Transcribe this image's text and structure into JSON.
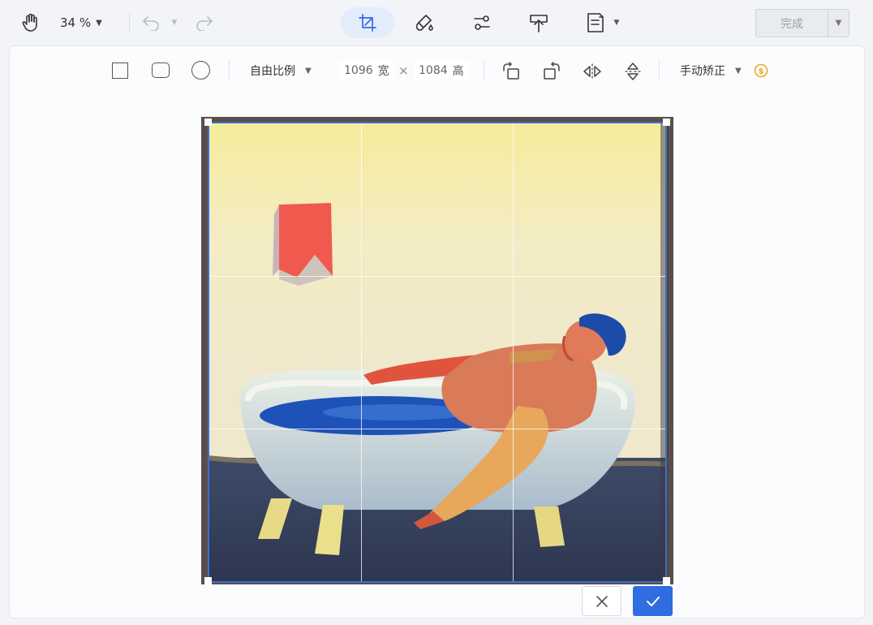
{
  "toolbar": {
    "zoom_value": "34 %",
    "done_label": "完成"
  },
  "crop_toolbar": {
    "ratio_label": "自由比例",
    "width_value": "1096",
    "width_unit": "宽",
    "times": "×",
    "height_value": "1084",
    "height_unit": "高",
    "straighten_label": "手动矫正"
  },
  "colors": {
    "accent": "#2f6de0",
    "active_tool_bg": "#e3ecfb",
    "premium_badge": "#f0a52a"
  },
  "icons": [
    "hand-icon",
    "undo-icon",
    "redo-icon",
    "crop-icon",
    "fill-icon",
    "adjust-icon",
    "upload-icon",
    "document-icon",
    "square-shape-icon",
    "rounded-square-shape-icon",
    "circle-shape-icon",
    "rotate-left-icon",
    "rotate-right-icon",
    "flip-horizontal-icon",
    "flip-vertical-icon",
    "coin-icon",
    "close-icon",
    "check-icon"
  ]
}
